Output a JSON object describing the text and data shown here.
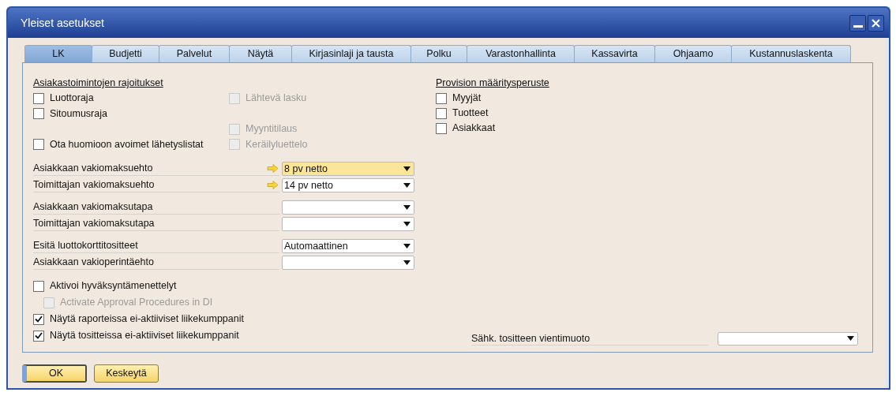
{
  "window": {
    "title": "Yleiset asetukset"
  },
  "tabs": [
    {
      "label": "LK",
      "selected": true
    },
    {
      "label": "Budjetti",
      "selected": false
    },
    {
      "label": "Palvelut",
      "selected": false
    },
    {
      "label": "Näytä",
      "selected": false
    },
    {
      "label": "Kirjasinlaji ja tausta",
      "selected": false
    },
    {
      "label": "Polku",
      "selected": false
    },
    {
      "label": "Varastonhallinta",
      "selected": false
    },
    {
      "label": "Kassavirta",
      "selected": false
    },
    {
      "label": "Ohjaamo",
      "selected": false
    },
    {
      "label": "Kustannuslaskenta",
      "selected": false
    }
  ],
  "restrictions": {
    "heading": "Asiakastoimintojen rajoitukset",
    "rows": [
      {
        "left": {
          "label": "Luottoraja",
          "checked": false,
          "disabled": false
        },
        "right": {
          "label": "Lähtevä lasku",
          "checked": false,
          "disabled": true
        }
      },
      {
        "left": {
          "label": "Sitoumusraja",
          "checked": false,
          "disabled": false
        }
      },
      {
        "right": {
          "label": "Myyntitilaus",
          "checked": false,
          "disabled": true
        }
      },
      {
        "left": {
          "label": "Ota huomioon avoimet lähetyslistat",
          "checked": false,
          "disabled": false
        },
        "right": {
          "label": "Keräilyluettelo",
          "checked": false,
          "disabled": true
        }
      }
    ]
  },
  "field_groups": [
    [
      {
        "label": "Asiakkaan vakiomaksuehto",
        "value": "8 pv netto",
        "link_arrow": true,
        "focused": true
      },
      {
        "label": "Toimittajan vakiomaksuehto",
        "value": "14 pv netto",
        "link_arrow": true,
        "focused": false
      }
    ],
    [
      {
        "label": "Asiakkaan vakiomaksutapa",
        "link_arrow": false,
        "focused": false
      },
      {
        "label": "Toimittajan vakiomaksutapa",
        "link_arrow": false,
        "focused": false
      }
    ],
    [
      {
        "label": "Esitä luottokorttitositteet",
        "value": "Automaattinen",
        "link_arrow": false,
        "focused": false
      },
      {
        "label": "Asiakkaan vakioperintäehto",
        "link_arrow": false,
        "focused": false
      }
    ]
  ],
  "options": [
    {
      "label": "Aktivoi hyväksyntämenettelyt",
      "checked": false,
      "disabled": false,
      "children": [
        {
          "label": "Activate Approval Procedures in DI",
          "checked": false,
          "disabled": true
        }
      ]
    },
    {
      "label": "Näytä raporteissa ei-aktiiviset liikekumppanit",
      "checked": true,
      "disabled": false
    },
    {
      "label": "Näytä tositteissa ei-aktiiviset liikekumppanit",
      "checked": true,
      "disabled": false
    }
  ],
  "commission": {
    "heading": "Provision määritysperuste",
    "items": [
      {
        "label": "Myyjät",
        "checked": false
      },
      {
        "label": "Tuotteet",
        "checked": false
      },
      {
        "label": "Asiakkaat",
        "checked": false
      }
    ]
  },
  "export_format": {
    "label": "Sähk. tositteen vientimuoto"
  },
  "buttons": [
    {
      "label": "OK",
      "kind": "default"
    },
    {
      "label": "Keskeytä",
      "kind": "normal"
    }
  ]
}
